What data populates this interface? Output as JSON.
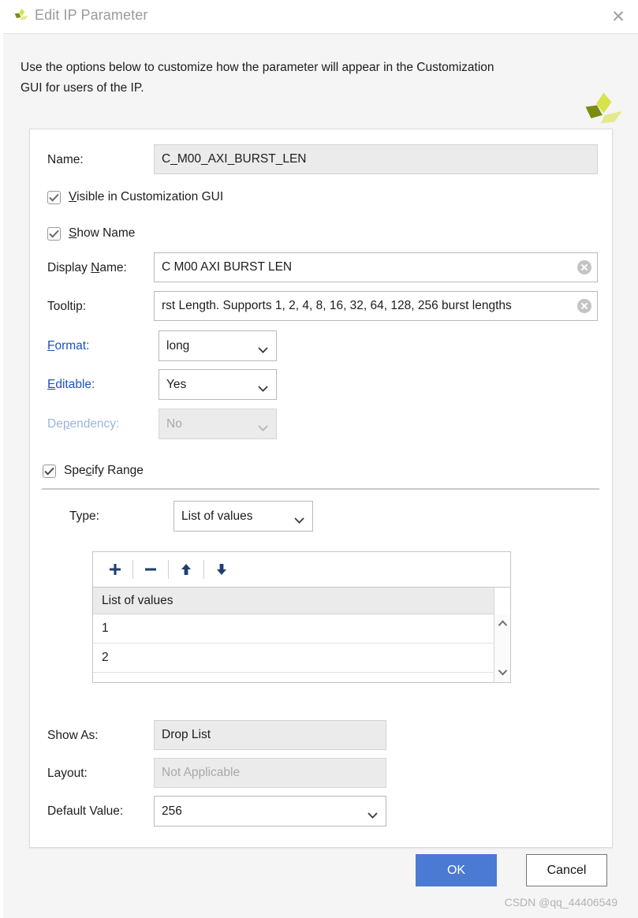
{
  "window": {
    "title": "Edit IP Parameter",
    "logo_icon": "xilinx-logo-icon",
    "close_icon": "close-icon"
  },
  "intro": {
    "text": "Use the options below to customize how the parameter will appear in the Customization GUI for users of the IP.",
    "logo_icon": "xilinx-logo-icon"
  },
  "form": {
    "name": {
      "label": "Name:",
      "value": "C_M00_AXI_BURST_LEN"
    },
    "visible_checkbox": {
      "label_pre": "",
      "label_mn": "V",
      "label_post": "isible in Customization GUI",
      "checked": true
    },
    "show_name_checkbox": {
      "label_pre": "",
      "label_mn": "S",
      "label_post": "how Name",
      "checked": true
    },
    "display_name": {
      "label_pre": "Display ",
      "label_mn": "N",
      "label_post": "ame:",
      "value": "C M00 AXI BURST LEN",
      "clear_icon": "clear-circle-icon"
    },
    "tooltip": {
      "label": "Tooltip:",
      "value": "rst Length. Supports 1, 2, 4, 8, 16, 32, 64, 128, 256 burst lengths",
      "clear_icon": "clear-circle-icon"
    },
    "format": {
      "label_pre": "",
      "label_mn": "F",
      "label_post": "ormat:",
      "value": "long",
      "chevron_icon": "chevron-down-icon"
    },
    "editable": {
      "label_pre": "",
      "label_mn": "E",
      "label_post": "ditable:",
      "value": "Yes",
      "chevron_icon": "chevron-down-icon"
    },
    "dependency": {
      "label_pre": "De",
      "label_mn": "p",
      "label_post": "endency:",
      "value": "No",
      "chevron_icon": "chevron-down-icon",
      "disabled": true
    },
    "specify_range_checkbox": {
      "label_pre": "Spe",
      "label_mn": "c",
      "label_post": "ify Range",
      "checked": true
    },
    "type": {
      "label": "Type:",
      "value": "List of values",
      "chevron_icon": "chevron-down-icon"
    },
    "show_as": {
      "label": "Show As:",
      "value": "Drop List"
    },
    "layout": {
      "label": "Layout:",
      "value": "Not Applicable",
      "disabled": true
    },
    "default_value": {
      "label": "Default Value:",
      "value": "256",
      "chevron_icon": "chevron-down-icon"
    }
  },
  "list_panel": {
    "toolbar": {
      "add_icon": "plus-icon",
      "remove_icon": "minus-icon",
      "move_up_icon": "arrow-up-icon",
      "move_down_icon": "arrow-down-icon"
    },
    "column_header": "List of values",
    "rows": [
      "1",
      "2"
    ],
    "scroll_up_icon": "chevron-up-icon",
    "scroll_down_icon": "chevron-down-icon"
  },
  "footer": {
    "ok_label": "OK",
    "cancel_label": "Cancel"
  },
  "watermark": "CSDN @qq_44406549",
  "colors": {
    "accent_blue": "#4b7ad2",
    "link_blue": "#1a51c7",
    "toolbar_icon": "#1f3f73",
    "logo_dark": "#7d8c11",
    "logo_light": "#d7e34a",
    "logo_mid": "#e3ea8a"
  }
}
